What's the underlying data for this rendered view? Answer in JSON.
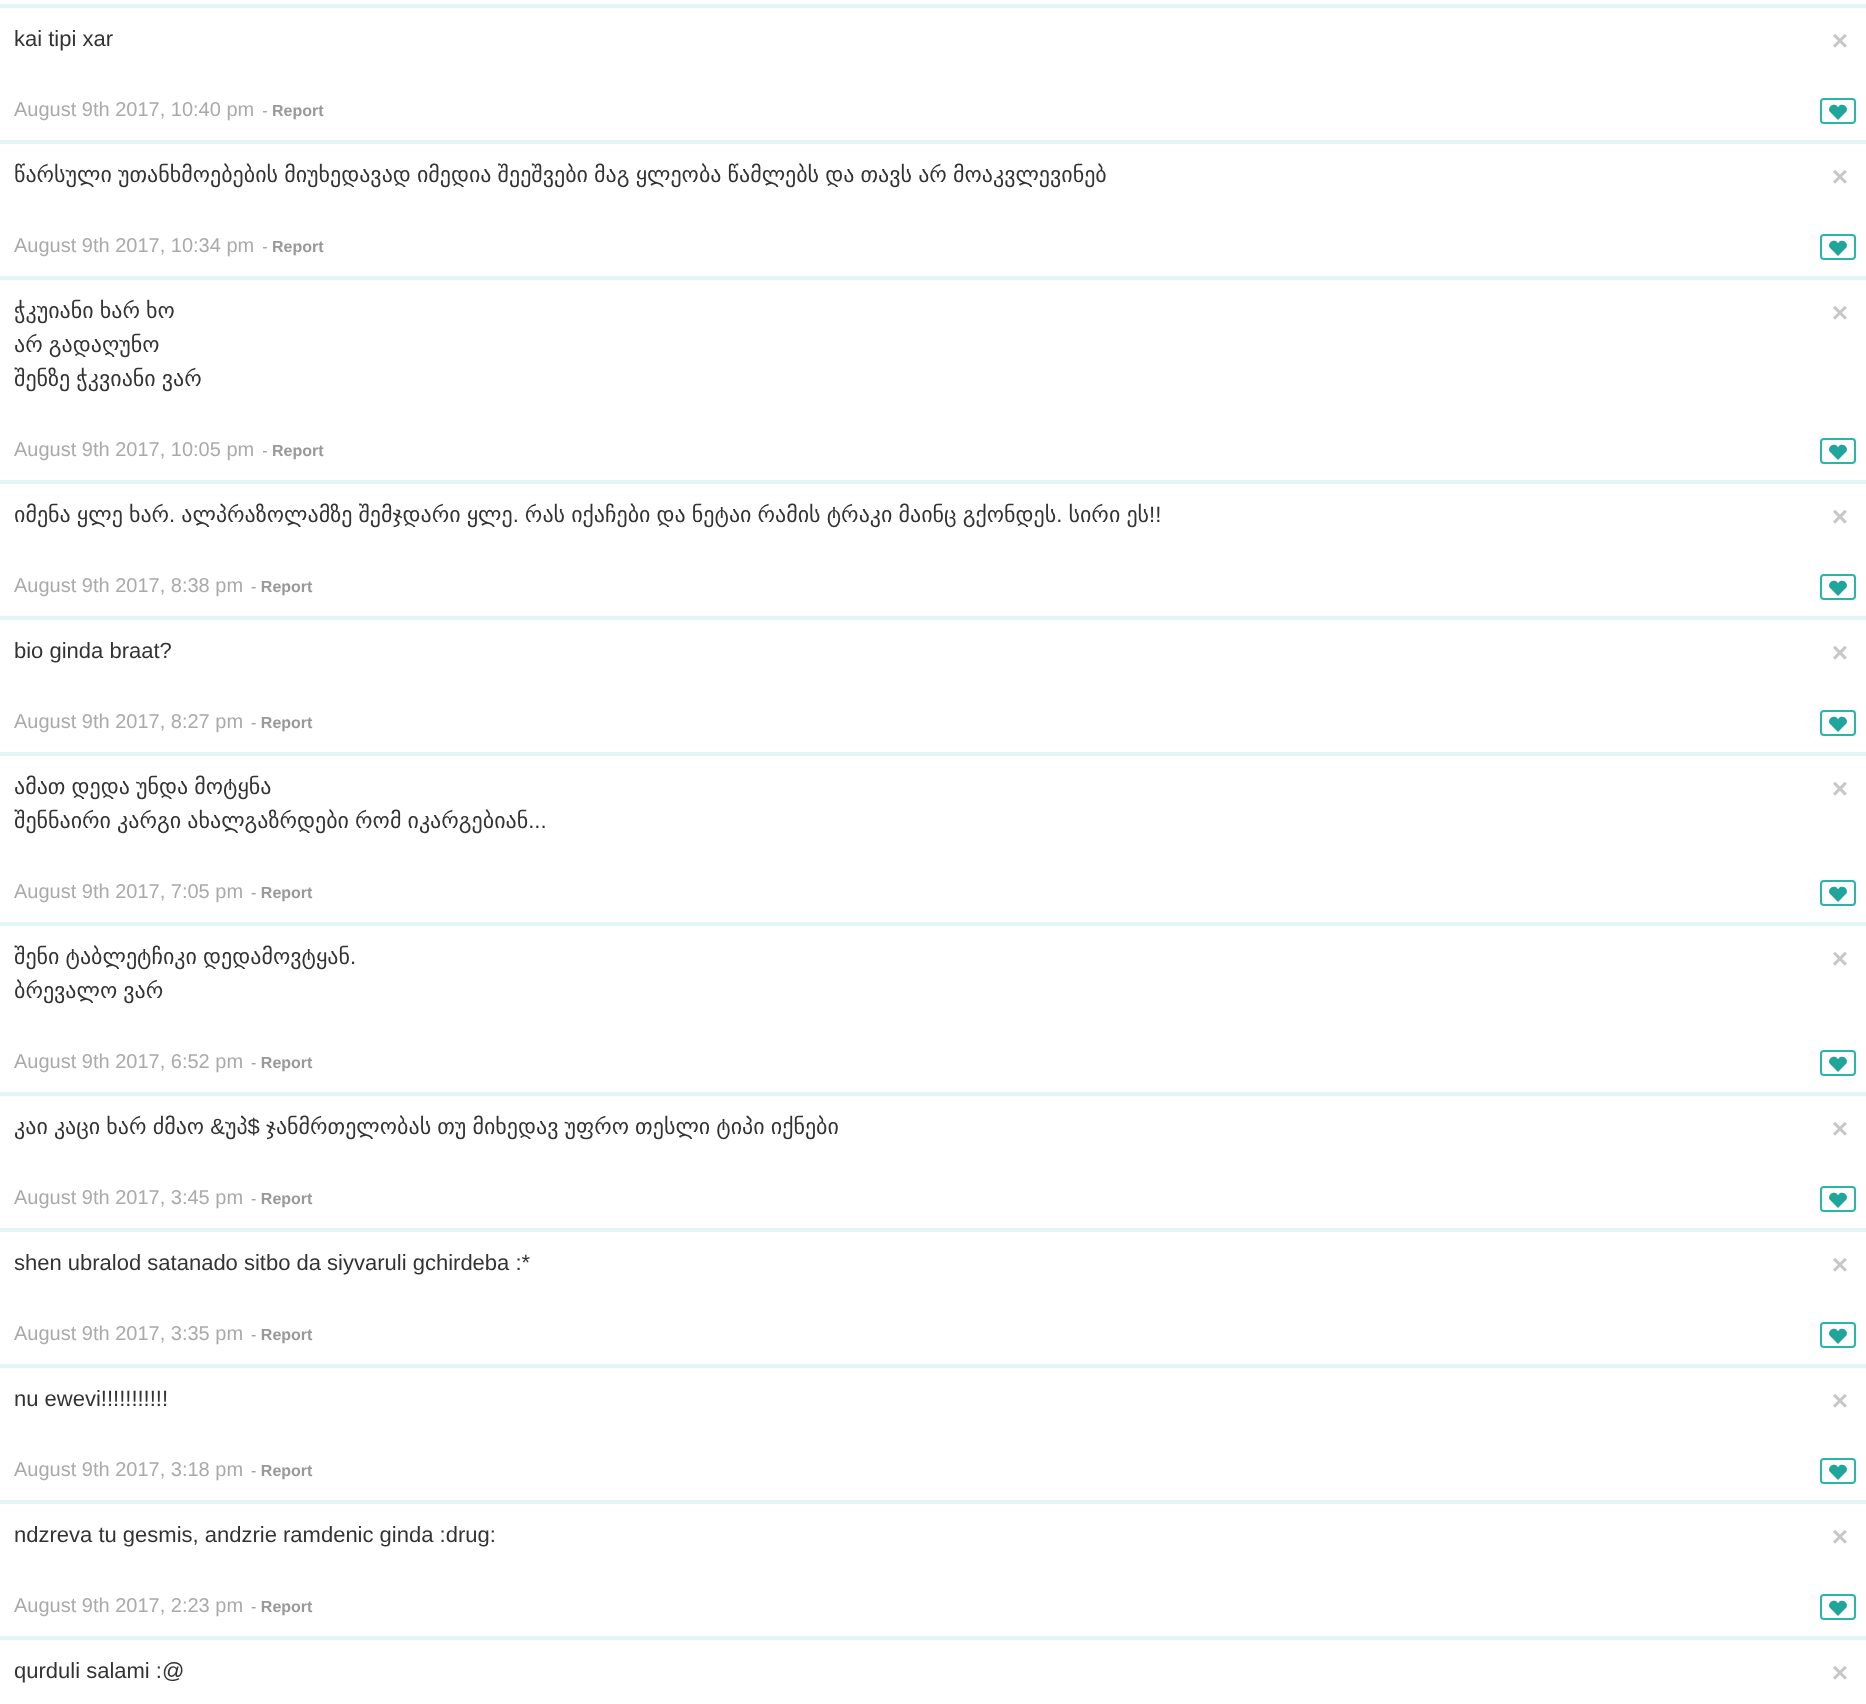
{
  "comments": [
    {
      "lines": [
        "kai tipi xar"
      ],
      "date": "August 9th 2017, 10:40 pm",
      "report": "- **Report**",
      "close": "×"
    },
    {
      "lines": [
        "წარსული უთანხმოებების მიუხედავად იმედია შეეშვები მაგ ყლეობა წამლებს და თავს არ მოაკვლევინებ"
      ],
      "date": "August 9th 2017, 10:34 pm",
      "report": "- **Report**",
      "close": "×"
    },
    {
      "lines": [
        "ჭკუიანი ხარ ხო",
        "არ გადაღუნო",
        "შენზე ჭკვიანი ვარ"
      ],
      "date": "August 9th 2017, 10:05 pm",
      "report": "- **Report**",
      "close": "×"
    },
    {
      "lines": [
        "იმენა ყლე ხარ. ალპრაზოლამზე შემჯდარი ყლე. რას იქაჩები და ნეტაი რამის ტრაკი მაინც გქონდეს. სირი ეს!!"
      ],
      "date": "August 9th 2017, 8:38 pm",
      "report": "- **Report**",
      "close": "×"
    },
    {
      "lines": [
        "bio ginda braat?"
      ],
      "date": "August 9th 2017, 8:27 pm",
      "report": "- **Report**",
      "close": "×"
    },
    {
      "lines": [
        "ამათ დედა უნდა მოტყნა",
        "შენნაირი კარგი ახალგაზრდები რომ იკარგებიან..."
      ],
      "date": "August 9th 2017, 7:05 pm",
      "report": "- **Report**",
      "close": "×"
    },
    {
      "lines": [
        "შენი ტაბლეტჩიკი დედამოვტყან.",
        "ბრევალო ვარ"
      ],
      "date": "August 9th 2017, 6:52 pm",
      "report": "- **Report**",
      "close": "×"
    },
    {
      "lines": [
        "კაი კაცი ხარ ძმაო &უპ$ ჯანმრთელობას თუ მიხედავ უფრო თესლი ტიპი იქნები"
      ],
      "date": "August 9th 2017, 3:45 pm",
      "report": "- **Report**",
      "close": "×"
    },
    {
      "lines": [
        "shen ubralod satanado sitbo da siyvaruli gchirdeba :*"
      ],
      "date": "August 9th 2017, 3:35 pm",
      "report": "- **Report**",
      "close": "×"
    },
    {
      "lines": [
        "nu ewevi!!!!!!!!!!!"
      ],
      "date": "August 9th 2017, 3:18 pm",
      "report": "- **Report**",
      "close": "×"
    },
    {
      "lines": [
        "ndzreva tu gesmis, andzrie ramdenic ginda :drug:"
      ],
      "date": "August 9th 2017, 2:23 pm",
      "report": "- **Report**",
      "close": "×"
    },
    {
      "lines": [
        "qurduli salami :@"
      ],
      "close": "×"
    }
  ]
}
